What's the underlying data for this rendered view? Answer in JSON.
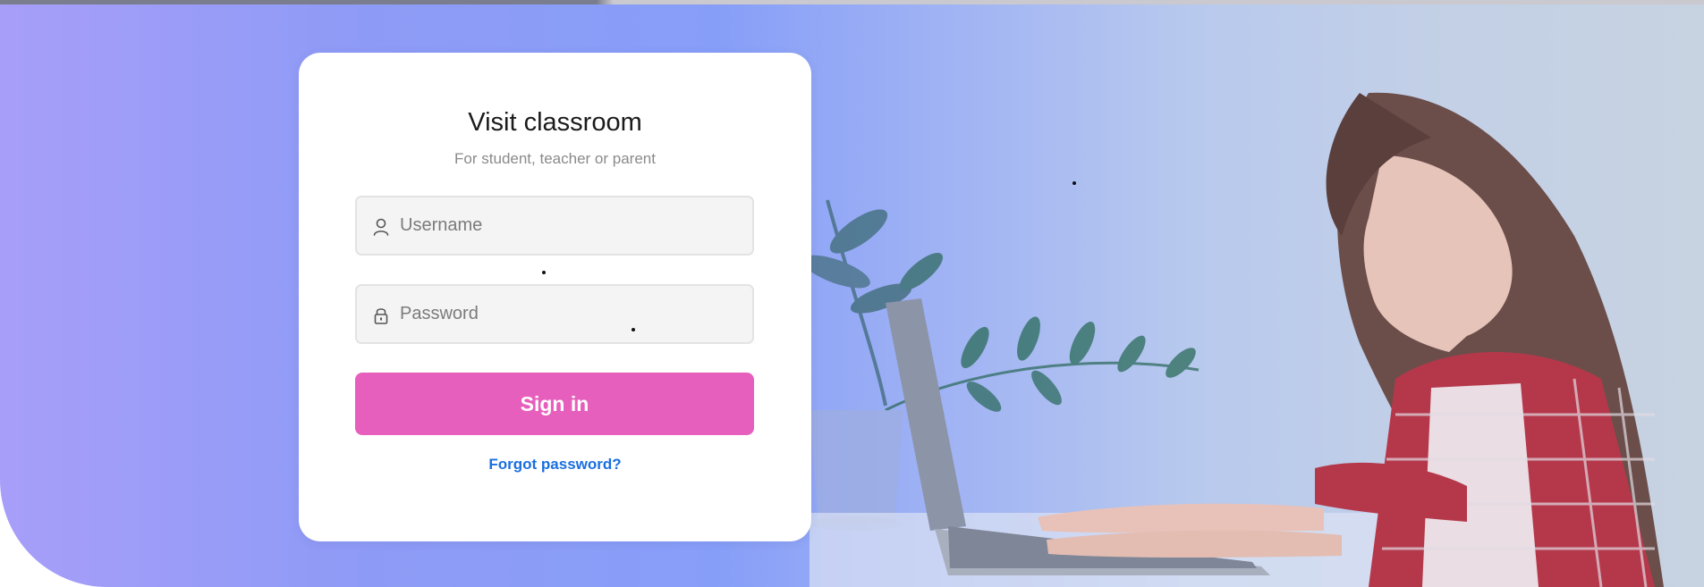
{
  "login": {
    "title": "Visit classroom",
    "subtitle": "For student, teacher or parent",
    "username_placeholder": "Username",
    "password_placeholder": "Password",
    "signin_label": "Sign in",
    "forgot_label": "Forgot password?"
  },
  "icons": {
    "username": "user-icon",
    "password": "lock-icon"
  },
  "colors": {
    "accent_button": "#e75fbd",
    "link": "#1a6fe0",
    "background_gradient_start": "#a79ef9",
    "background_gradient_end": "#c7d3e1"
  }
}
